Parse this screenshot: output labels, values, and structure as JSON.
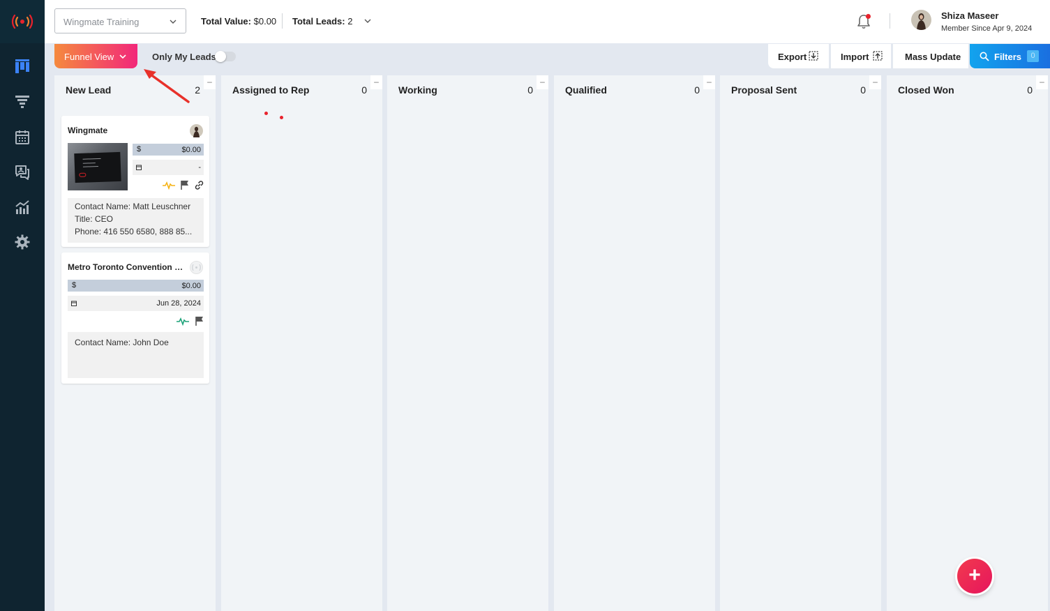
{
  "header": {
    "board_select": "Wingmate Training",
    "total_value_label": "Total Value:",
    "total_value": "$0.00",
    "total_leads_label": "Total Leads:",
    "total_leads": "2",
    "user_name": "Shiza Maseer",
    "user_since": "Member Since Apr 9, 2024"
  },
  "toolbar": {
    "view_label": "Funnel View",
    "only_my_leads": "Only My Leads",
    "only_my_leads_on": false,
    "export": "Export",
    "import": "Import",
    "mass_update": "Mass Update",
    "filters": "Filters",
    "filters_count": "0"
  },
  "columns": [
    {
      "title": "New Lead",
      "count": "2"
    },
    {
      "title": "Assigned to Rep",
      "count": "0"
    },
    {
      "title": "Working",
      "count": "0"
    },
    {
      "title": "Qualified",
      "count": "0"
    },
    {
      "title": "Proposal Sent",
      "count": "0"
    },
    {
      "title": "Closed Won",
      "count": "0"
    }
  ],
  "cards": [
    {
      "title": "Wingmate",
      "value_symbol": "$",
      "value": "$0.00",
      "date": "-",
      "contact_name_label": "Contact Name:",
      "contact_name": "Matt Leuschner",
      "title_label": "Title:",
      "contact_title": "CEO",
      "phone_label": "Phone:",
      "phone": "416 550 6580, 888 85..."
    },
    {
      "title": "Metro Toronto Convention Ce...",
      "value_symbol": "$",
      "value": "$0.00",
      "date": "Jun 28, 2024",
      "contact_name_label": "Contact Name:",
      "contact_name": "John Doe"
    }
  ],
  "icons": {
    "sidebar": [
      "wingmate-logo-icon",
      "kanban-icon",
      "funnel-icon",
      "calendar-icon",
      "chat-icon",
      "analytics-icon",
      "settings-icon"
    ],
    "fab": "plus-icon"
  },
  "colors": {
    "sidebar": "#0f2430",
    "funnel_gradient_start": "#f58a3e",
    "funnel_gradient_end": "#f2277a",
    "filters_gradient_start": "#12a3ee",
    "filters_gradient_end": "#1a6fe0",
    "fab": "#f23a4e",
    "annotation_arrow": "#e8312a"
  }
}
